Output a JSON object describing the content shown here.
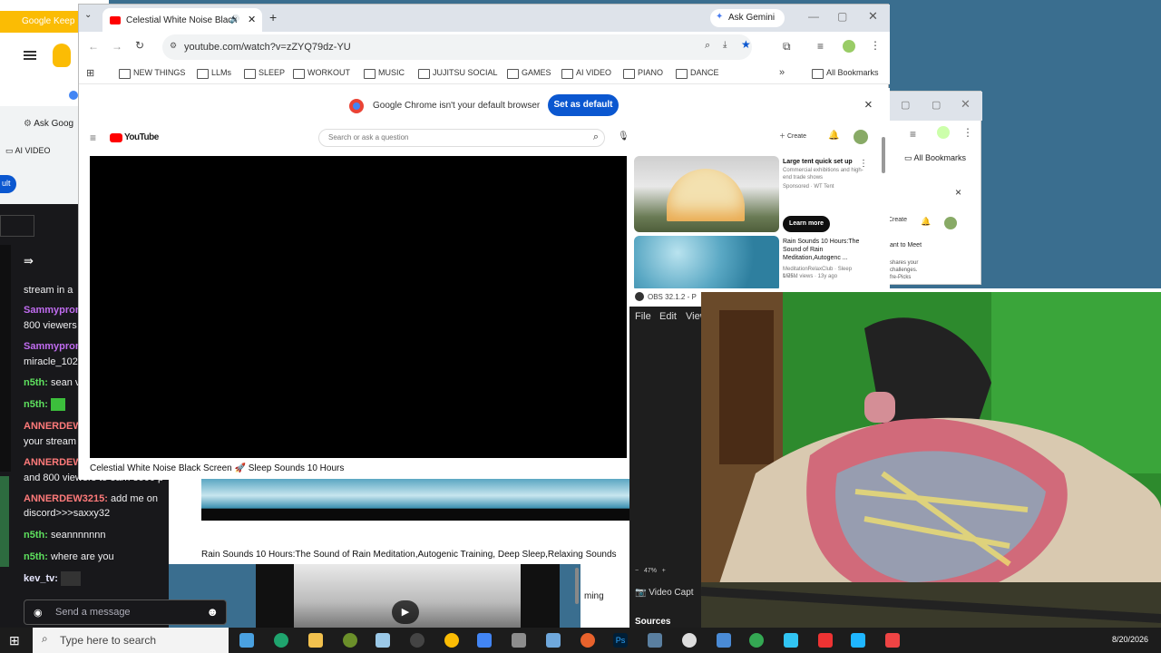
{
  "keep": {
    "tab_title": "Google Keep"
  },
  "left_chrome": {
    "ask_label": "Ask Goog",
    "bookmark_label": "AI VIDEO"
  },
  "chat": {
    "messages": [
      {
        "user": "",
        "text": "stream in a"
      },
      {
        "user": "Sammypron",
        "text": ""
      },
      {
        "user": "",
        "text": "800 viewers"
      },
      {
        "user": "Sammypron",
        "text": ""
      },
      {
        "user": "",
        "text": "miracle_102"
      },
      {
        "user": "n5th:",
        "text": "sean v"
      },
      {
        "user": "n5th:",
        "text": ""
      },
      {
        "user": "ANNERDEW",
        "text": ""
      },
      {
        "user": "",
        "text": "your stream"
      },
      {
        "user": "ANNERDEW",
        "text": ""
      },
      {
        "user": "",
        "text": "and 800 viewers to earn 3500 p"
      },
      {
        "user": "ANNERDEW3215:",
        "text": "add me on"
      },
      {
        "user": "",
        "text": "discord>>>saxxy32"
      },
      {
        "user": "n5th:",
        "text": "seannnnnnn"
      },
      {
        "user": "n5th:",
        "text": "where are you"
      },
      {
        "user": "kev_tv:",
        "text": ""
      }
    ],
    "input_placeholder": "Send a message"
  },
  "chrome": {
    "tab_title": "Celestial White Noise Black",
    "new_tab": "+",
    "ask_gemini": "Ask Gemini",
    "url": "youtube.com/watch?v=zZYQ79dz-YU",
    "bookmarks": [
      "NEW THINGS",
      "LLMs",
      "SLEEP",
      "WORKOUT",
      "MUSIC",
      "JUJITSU SOCIAL",
      "GAMES",
      "AI VIDEO",
      "PIANO",
      "DANCE"
    ],
    "bookmarks_more": "»",
    "all_bookmarks": "All Bookmarks",
    "infobar_text": "Google Chrome isn't your default browser",
    "set_default": "Set as default",
    "close": "×"
  },
  "youtube": {
    "logo_text": "YouTube",
    "search_placeholder": "Search or ask a question",
    "create_label": "Create",
    "video_title": "Celestial White Noise Black Screen 🚀 Sleep Sounds 10 Hours",
    "ad": {
      "title": "Large tent quick set up",
      "desc": "Commercial exhibitions and high-end trade shows",
      "sponsor": "Sponsored · WT Tent",
      "cta": "Learn more"
    },
    "rec": {
      "title": "Rain Sounds 10 Hours:The Sound of Rain Meditation,Autogenc ...",
      "channel": "MeditationRelaxClub · Sleep Mus...",
      "views": "1.75M views · 13y ago"
    }
  },
  "youtube2": {
    "video_title": "Rain Sounds 10 Hours:The Sound of Rain Meditation,Autogenic Training, Deep Sleep,Relaxing Sounds"
  },
  "chrome2": {
    "all_bookmarks": "All Bookmarks",
    "create_label": "Create",
    "meet_text": "ant to Meet",
    "snippet": [
      "shares your",
      "challenges.",
      "fre-Picks"
    ]
  },
  "obs": {
    "title": "OBS 32.1.2 - P",
    "menu": [
      "File",
      "Edit",
      "View"
    ],
    "zoom": "47%",
    "source": "Video Capt",
    "sources_label": "Sources",
    "timing": "ming"
  },
  "taskbar": {
    "search_placeholder": "Type here to search",
    "date": "8/20/2026"
  }
}
